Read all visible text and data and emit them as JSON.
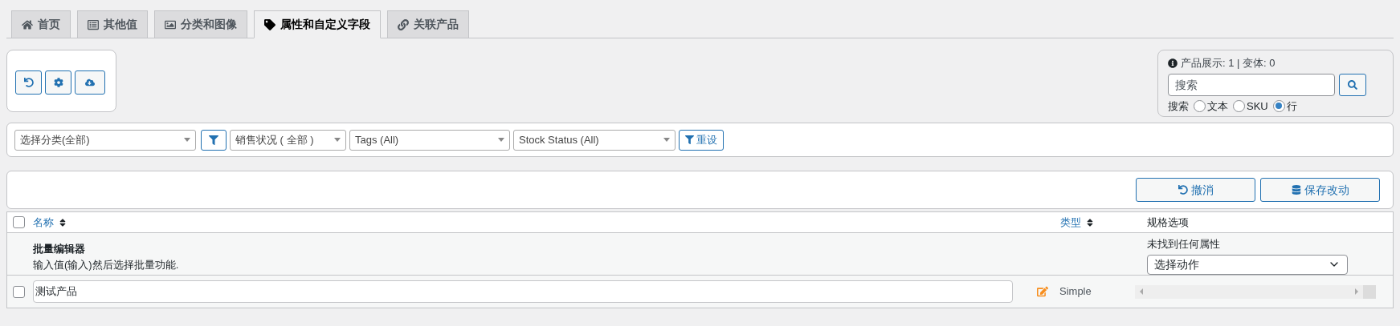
{
  "tabs": [
    {
      "label": "首页",
      "selected": false
    },
    {
      "label": "其他值",
      "selected": false
    },
    {
      "label": "分类和图像",
      "selected": false
    },
    {
      "label": "属性和自定义字段",
      "selected": true
    },
    {
      "label": "关联产品",
      "selected": false
    }
  ],
  "search": {
    "summary": "产品展示: 1 | 变体: 0",
    "placeholder": "搜索",
    "label": "搜索",
    "modes": [
      {
        "label": "文本",
        "selected": false
      },
      {
        "label": "SKU",
        "selected": false
      },
      {
        "label": "行",
        "selected": true
      }
    ]
  },
  "filters": [
    {
      "kind": "select",
      "value": "选择分类(全部)"
    },
    {
      "kind": "filter_button"
    },
    {
      "kind": "select",
      "value": "销售状况 ( 全部 )"
    },
    {
      "kind": "select",
      "value": "Tags (All)"
    },
    {
      "kind": "select",
      "value": "Stock Status (All)"
    },
    {
      "kind": "reset_button",
      "label": "重设"
    }
  ],
  "actions": [
    {
      "kind": "undo",
      "label": "撤消"
    },
    {
      "kind": "save",
      "label": "保存改动"
    }
  ],
  "table": {
    "all_checked": false,
    "columns": [
      {
        "label": "名称",
        "sortable": true
      },
      {
        "label": "类型",
        "sortable": true
      },
      {
        "label": "规格选项",
        "sortable": false
      }
    ],
    "bulk_editor": {
      "title": "批量编辑器",
      "hint": "输入值(输入)然后选择批量功能.",
      "notice": "未找到任何属性",
      "action_select": "选择动作"
    },
    "rows": [
      {
        "checked": false,
        "name": "测试产品",
        "type": "Simple"
      }
    ]
  }
}
